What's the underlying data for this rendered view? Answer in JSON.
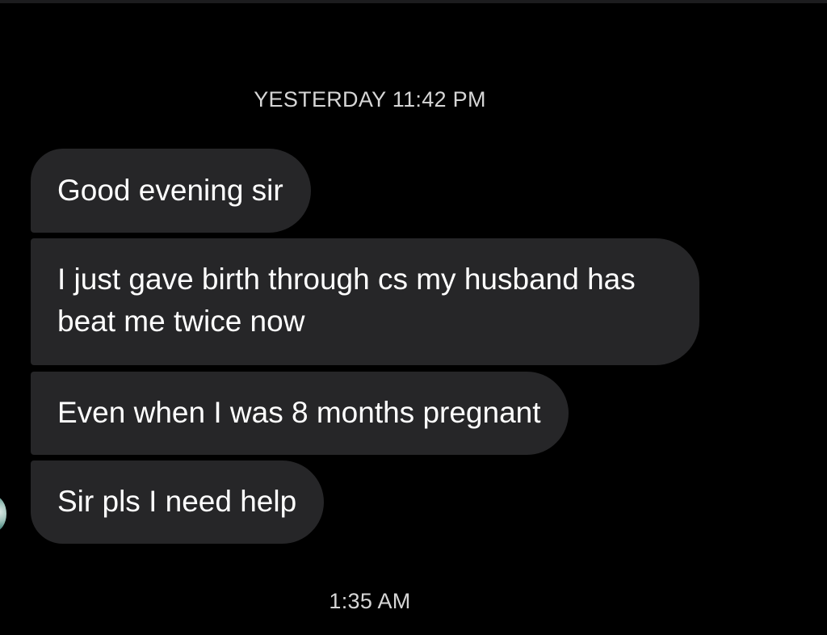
{
  "thread": {
    "timestamp_top": "YESTERDAY 11:42 PM",
    "timestamp_bottom": "1:35 AM",
    "messages": [
      {
        "text": "Good evening sir"
      },
      {
        "text": "I just gave birth through cs my husband has beat me twice now"
      },
      {
        "text": "Even when I was 8 months pregnant"
      },
      {
        "text": "Sir pls I need help"
      }
    ]
  },
  "colors": {
    "background": "#000000",
    "bubble": "#262628",
    "text": "#ffffff",
    "timestamp": "#d6d6d6"
  }
}
